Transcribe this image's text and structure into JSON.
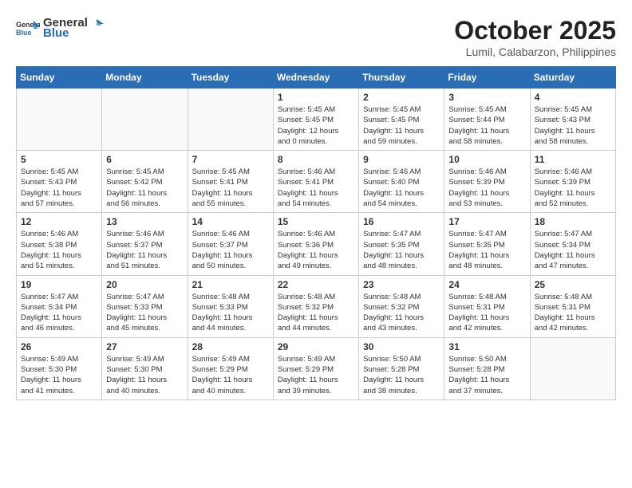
{
  "header": {
    "logo_general": "General",
    "logo_blue": "Blue",
    "month": "October 2025",
    "location": "Lumil, Calabarzon, Philippines"
  },
  "days_of_week": [
    "Sunday",
    "Monday",
    "Tuesday",
    "Wednesday",
    "Thursday",
    "Friday",
    "Saturday"
  ],
  "weeks": [
    [
      {
        "day": "",
        "info": ""
      },
      {
        "day": "",
        "info": ""
      },
      {
        "day": "",
        "info": ""
      },
      {
        "day": "1",
        "info": "Sunrise: 5:45 AM\nSunset: 5:45 PM\nDaylight: 12 hours\nand 0 minutes."
      },
      {
        "day": "2",
        "info": "Sunrise: 5:45 AM\nSunset: 5:45 PM\nDaylight: 11 hours\nand 59 minutes."
      },
      {
        "day": "3",
        "info": "Sunrise: 5:45 AM\nSunset: 5:44 PM\nDaylight: 11 hours\nand 58 minutes."
      },
      {
        "day": "4",
        "info": "Sunrise: 5:45 AM\nSunset: 5:43 PM\nDaylight: 11 hours\nand 58 minutes."
      }
    ],
    [
      {
        "day": "5",
        "info": "Sunrise: 5:45 AM\nSunset: 5:43 PM\nDaylight: 11 hours\nand 57 minutes."
      },
      {
        "day": "6",
        "info": "Sunrise: 5:45 AM\nSunset: 5:42 PM\nDaylight: 11 hours\nand 56 minutes."
      },
      {
        "day": "7",
        "info": "Sunrise: 5:45 AM\nSunset: 5:41 PM\nDaylight: 11 hours\nand 55 minutes."
      },
      {
        "day": "8",
        "info": "Sunrise: 5:46 AM\nSunset: 5:41 PM\nDaylight: 11 hours\nand 54 minutes."
      },
      {
        "day": "9",
        "info": "Sunrise: 5:46 AM\nSunset: 5:40 PM\nDaylight: 11 hours\nand 54 minutes."
      },
      {
        "day": "10",
        "info": "Sunrise: 5:46 AM\nSunset: 5:39 PM\nDaylight: 11 hours\nand 53 minutes."
      },
      {
        "day": "11",
        "info": "Sunrise: 5:46 AM\nSunset: 5:39 PM\nDaylight: 11 hours\nand 52 minutes."
      }
    ],
    [
      {
        "day": "12",
        "info": "Sunrise: 5:46 AM\nSunset: 5:38 PM\nDaylight: 11 hours\nand 51 minutes."
      },
      {
        "day": "13",
        "info": "Sunrise: 5:46 AM\nSunset: 5:37 PM\nDaylight: 11 hours\nand 51 minutes."
      },
      {
        "day": "14",
        "info": "Sunrise: 5:46 AM\nSunset: 5:37 PM\nDaylight: 11 hours\nand 50 minutes."
      },
      {
        "day": "15",
        "info": "Sunrise: 5:46 AM\nSunset: 5:36 PM\nDaylight: 11 hours\nand 49 minutes."
      },
      {
        "day": "16",
        "info": "Sunrise: 5:47 AM\nSunset: 5:35 PM\nDaylight: 11 hours\nand 48 minutes."
      },
      {
        "day": "17",
        "info": "Sunrise: 5:47 AM\nSunset: 5:35 PM\nDaylight: 11 hours\nand 48 minutes."
      },
      {
        "day": "18",
        "info": "Sunrise: 5:47 AM\nSunset: 5:34 PM\nDaylight: 11 hours\nand 47 minutes."
      }
    ],
    [
      {
        "day": "19",
        "info": "Sunrise: 5:47 AM\nSunset: 5:34 PM\nDaylight: 11 hours\nand 46 minutes."
      },
      {
        "day": "20",
        "info": "Sunrise: 5:47 AM\nSunset: 5:33 PM\nDaylight: 11 hours\nand 45 minutes."
      },
      {
        "day": "21",
        "info": "Sunrise: 5:48 AM\nSunset: 5:33 PM\nDaylight: 11 hours\nand 44 minutes."
      },
      {
        "day": "22",
        "info": "Sunrise: 5:48 AM\nSunset: 5:32 PM\nDaylight: 11 hours\nand 44 minutes."
      },
      {
        "day": "23",
        "info": "Sunrise: 5:48 AM\nSunset: 5:32 PM\nDaylight: 11 hours\nand 43 minutes."
      },
      {
        "day": "24",
        "info": "Sunrise: 5:48 AM\nSunset: 5:31 PM\nDaylight: 11 hours\nand 42 minutes."
      },
      {
        "day": "25",
        "info": "Sunrise: 5:48 AM\nSunset: 5:31 PM\nDaylight: 11 hours\nand 42 minutes."
      }
    ],
    [
      {
        "day": "26",
        "info": "Sunrise: 5:49 AM\nSunset: 5:30 PM\nDaylight: 11 hours\nand 41 minutes."
      },
      {
        "day": "27",
        "info": "Sunrise: 5:49 AM\nSunset: 5:30 PM\nDaylight: 11 hours\nand 40 minutes."
      },
      {
        "day": "28",
        "info": "Sunrise: 5:49 AM\nSunset: 5:29 PM\nDaylight: 11 hours\nand 40 minutes."
      },
      {
        "day": "29",
        "info": "Sunrise: 5:49 AM\nSunset: 5:29 PM\nDaylight: 11 hours\nand 39 minutes."
      },
      {
        "day": "30",
        "info": "Sunrise: 5:50 AM\nSunset: 5:28 PM\nDaylight: 11 hours\nand 38 minutes."
      },
      {
        "day": "31",
        "info": "Sunrise: 5:50 AM\nSunset: 5:28 PM\nDaylight: 11 hours\nand 37 minutes."
      },
      {
        "day": "",
        "info": ""
      }
    ]
  ]
}
